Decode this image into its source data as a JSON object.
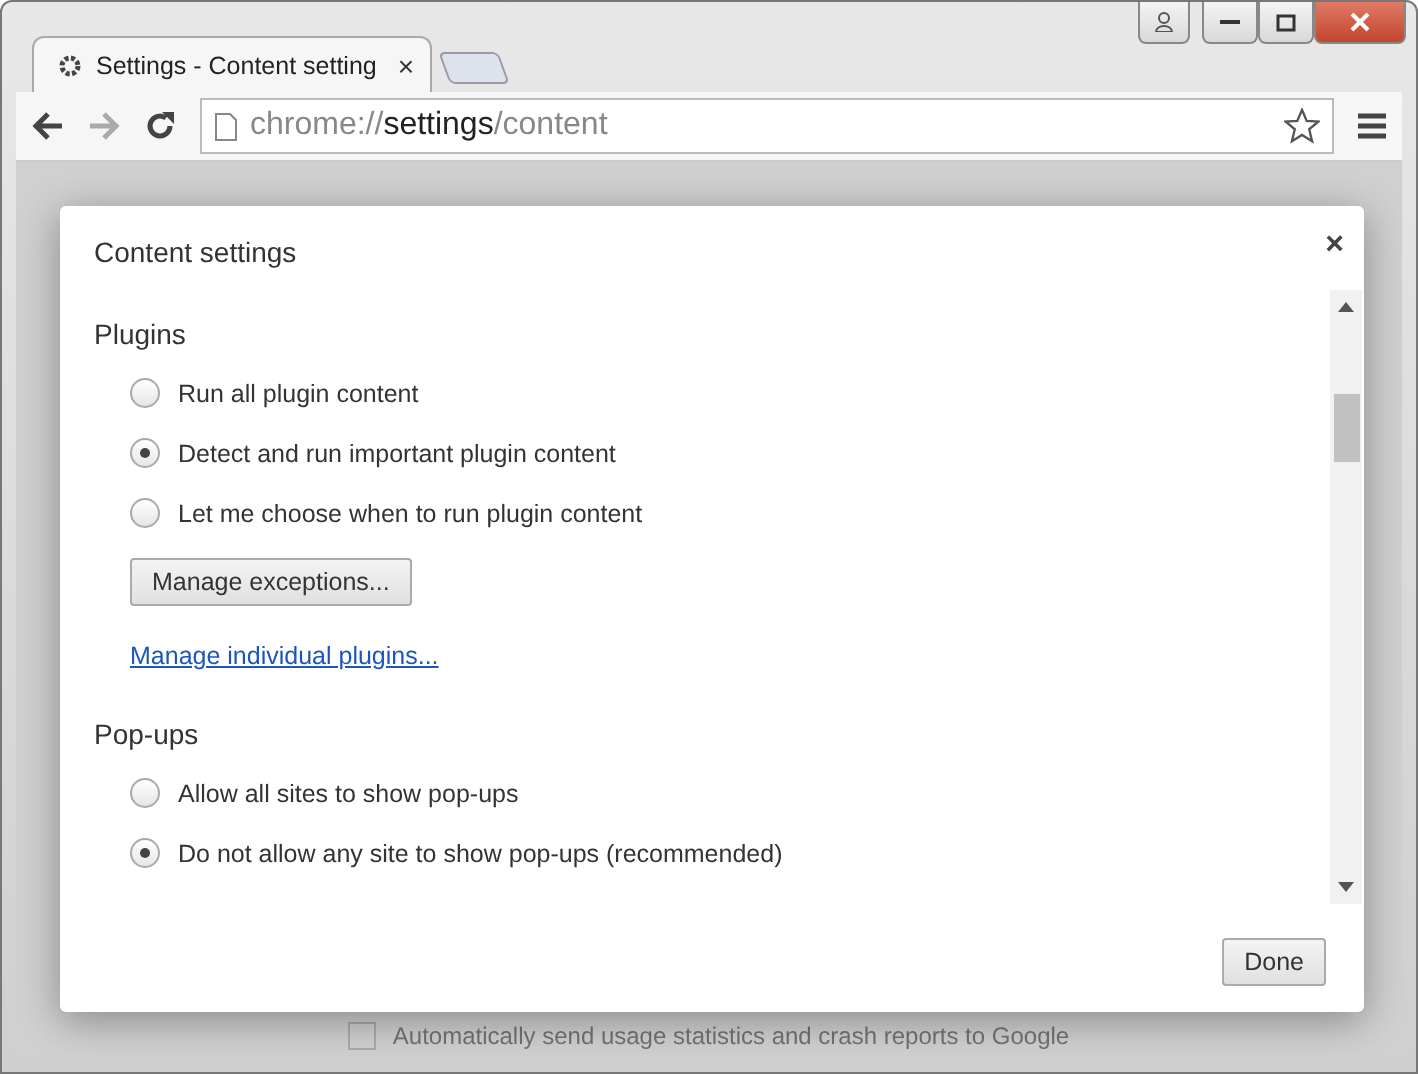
{
  "tab": {
    "title": "Settings - Content setting",
    "close": "×"
  },
  "address": {
    "scheme": "chrome://",
    "host": "settings",
    "path": "/content"
  },
  "background": {
    "checkbox": {
      "label": "Automatically send usage statistics and crash reports to Google",
      "checked": false
    }
  },
  "dialog": {
    "title": "Content settings",
    "close": "×",
    "sections": [
      {
        "heading": "Plugins",
        "options": [
          {
            "label": "Run all plugin content",
            "selected": false
          },
          {
            "label": "Detect and run important plugin content",
            "selected": true
          },
          {
            "label": "Let me choose when to run plugin content",
            "selected": false
          }
        ],
        "button": "Manage exceptions...",
        "link": "Manage individual plugins..."
      },
      {
        "heading": "Pop-ups",
        "options": [
          {
            "label": "Allow all sites to show pop-ups",
            "selected": false
          },
          {
            "label": "Do not allow any site to show pop-ups (recommended)",
            "selected": true
          }
        ]
      }
    ],
    "done": "Done"
  }
}
